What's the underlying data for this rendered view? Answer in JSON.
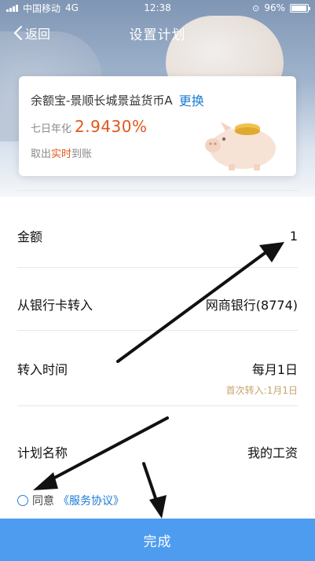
{
  "status_bar": {
    "carrier": "中国移动",
    "network": "4G",
    "time": "12:38",
    "battery": "96%"
  },
  "nav": {
    "back_label": "返回",
    "title": "设置计划"
  },
  "fund_card": {
    "name": "余额宝-景顺长城景益货币A",
    "change_label": "更换",
    "yield_label": "七日年化",
    "yield_value": "2.9430%",
    "withdraw_prefix": "取出",
    "withdraw_highlight": "实时",
    "withdraw_suffix": "到账"
  },
  "form": {
    "amount_label": "金额",
    "amount_value": "1",
    "source_label": "从银行卡转入",
    "source_value": "网商银行(8774)",
    "time_label": "转入时间",
    "time_value": "每月1日",
    "time_sub": "首次转入:1月1日",
    "plan_name_label": "计划名称",
    "plan_name_value": "我的工资"
  },
  "agreement": {
    "agree_text": "同意",
    "link_text": "《服务协议》"
  },
  "submit": {
    "label": "完成"
  },
  "colors": {
    "accent_blue": "#4e9cf0",
    "link_blue": "#1a7ad4",
    "yield_orange": "#e2561c",
    "sub_gold": "#c7a36a"
  }
}
